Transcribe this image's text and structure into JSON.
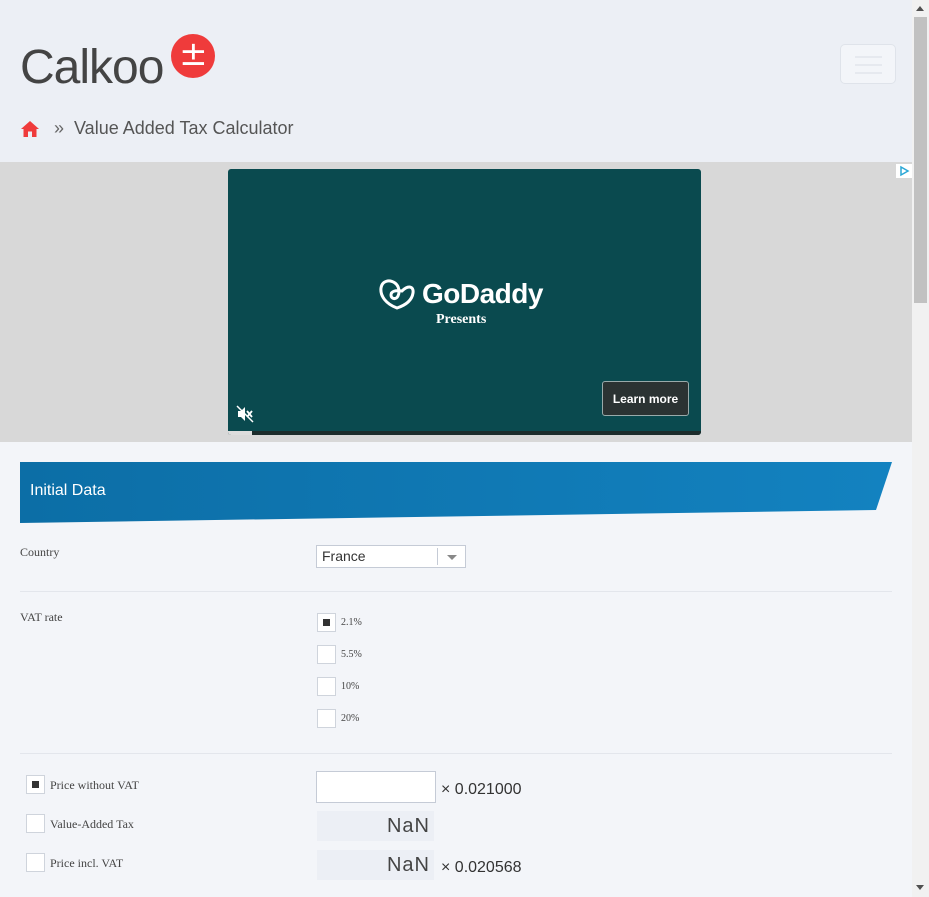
{
  "header": {
    "logo_text": "Calkoo",
    "logo_badge": "±",
    "breadcrumb_sep": "»",
    "breadcrumb_current": "Value Added Tax Calculator"
  },
  "ad": {
    "brand": "GoDaddy",
    "subtitle": "Presents",
    "cta": "Learn more",
    "progress_fraction": 0.05
  },
  "section": {
    "title": "Initial Data"
  },
  "form": {
    "country_label": "Country",
    "country_value": "France",
    "vat_label": "VAT rate",
    "vat_options": [
      "2.1%",
      "5.5%",
      "10%",
      "20%"
    ],
    "vat_selected": 0,
    "fields": [
      {
        "label": "Price without VAT",
        "value": "",
        "factor": "× 0.021000",
        "checked": true
      },
      {
        "label": "Value-Added Tax",
        "value": "NaN",
        "factor": "",
        "checked": false
      },
      {
        "label": "Price incl. VAT",
        "value": "NaN",
        "factor": "× 0.020568",
        "checked": false
      }
    ]
  },
  "colors": {
    "accent_red": "#ef3b3b",
    "banner_blue": "#0e78b4",
    "ad_green": "#0a4a4f"
  }
}
